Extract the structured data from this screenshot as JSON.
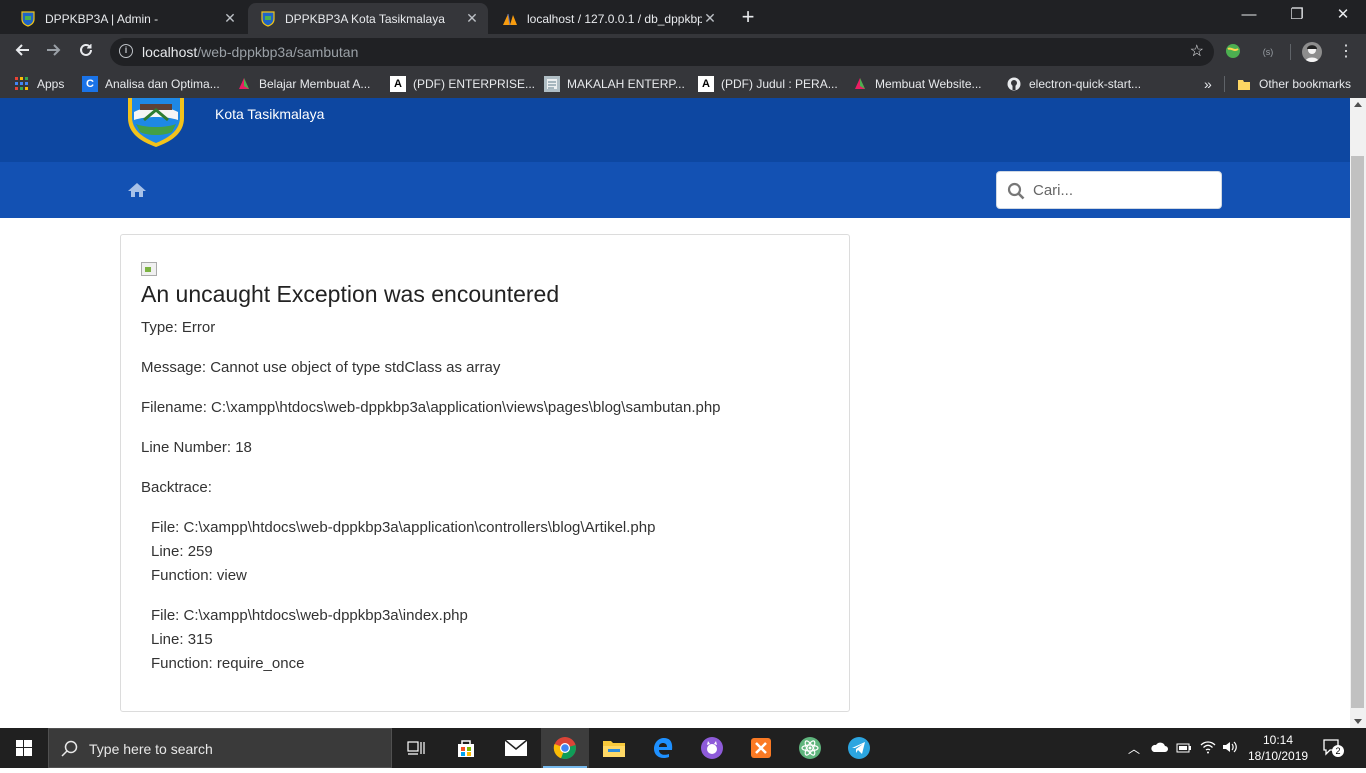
{
  "browser": {
    "tabs": [
      {
        "title": "DPPKBP3A | Admin -",
        "active": false
      },
      {
        "title": "DPPKBP3A Kota Tasikmalaya",
        "active": true
      },
      {
        "title": "localhost / 127.0.0.1 / db_dppkbp3a",
        "active": false
      }
    ],
    "address": {
      "host": "localhost",
      "path": "/web-dppkbp3a/sambutan"
    },
    "bookmarks": [
      {
        "label": "Apps",
        "icon": "apps-grid-icon"
      },
      {
        "label": "Analisa dan Optima...",
        "icon": "c-letter-icon"
      },
      {
        "label": "Belajar Membuat A...",
        "icon": "bird-icon"
      },
      {
        "label": "(PDF) ENTERPRISE...",
        "icon": "academia-icon"
      },
      {
        "label": "MAKALAH ENTERP...",
        "icon": "document-thumb-icon"
      },
      {
        "label": "(PDF) Judul : PERA...",
        "icon": "academia-icon"
      },
      {
        "label": "Membuat Website...",
        "icon": "bird-icon"
      },
      {
        "label": "electron-quick-start...",
        "icon": "github-icon"
      }
    ],
    "overflow_label": "»",
    "other_bookmarks": "Other bookmarks"
  },
  "site": {
    "city": "Kota Tasikmalaya",
    "search_placeholder": "Cari..."
  },
  "error": {
    "title": "An uncaught Exception was encountered",
    "type": "Type: Error",
    "message": "Message: Cannot use object of type stdClass as array",
    "filename": "Filename: C:\\xampp\\htdocs\\web-dppkbp3a\\application\\views\\pages\\blog\\sambutan.php",
    "line_number": "Line Number: 18",
    "backtrace_label": "Backtrace:",
    "backtrace": [
      {
        "file": "File: C:\\xampp\\htdocs\\web-dppkbp3a\\application\\controllers\\blog\\Artikel.php",
        "line": "Line: 259",
        "function": "Function: view"
      },
      {
        "file": "File: C:\\xampp\\htdocs\\web-dppkbp3a\\index.php",
        "line": "Line: 315",
        "function": "Function: require_once"
      }
    ]
  },
  "taskbar": {
    "search_placeholder": "Type here to search",
    "time": "10:14",
    "date": "18/10/2019",
    "notification_count": "2"
  },
  "colors": {
    "header_blue": "#0d47a1",
    "navbar_blue": "#1351b3",
    "chrome_dark": "#202124",
    "chrome_toolbar": "#35363a"
  }
}
